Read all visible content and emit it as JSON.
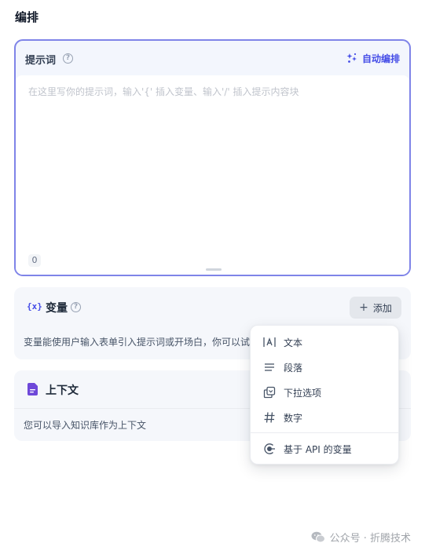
{
  "section_title": "编排",
  "prompt": {
    "title": "提示词",
    "help_icon": "?",
    "auto_button_label": "自动编排",
    "placeholder": "在这里写你的提示词，输入'{' 插入变量、输入'/' 插入提示内容块",
    "value": "",
    "char_count": "0"
  },
  "variables": {
    "icon": "{x}",
    "title": "变量",
    "help_icon": "?",
    "add_label": "添加",
    "description": "变量能使用户输入表单引入提示词或开场白，你可以试"
  },
  "context": {
    "title": "上下文",
    "description": "您可以导入知识库作为上下文"
  },
  "add_menu": {
    "items": [
      {
        "label": "文本",
        "icon": "text-icon"
      },
      {
        "label": "段落",
        "icon": "paragraph-icon"
      },
      {
        "label": "下拉选项",
        "icon": "select-icon"
      },
      {
        "label": "数字",
        "icon": "number-icon"
      },
      {
        "label": "基于 API 的变量",
        "icon": "api-icon"
      }
    ]
  },
  "watermark": {
    "text": "公众号 · 折腾技术"
  },
  "colors": {
    "accent": "#444ce7",
    "focus_border": "#7f84e8",
    "card_bg": "#f5f7fb"
  }
}
